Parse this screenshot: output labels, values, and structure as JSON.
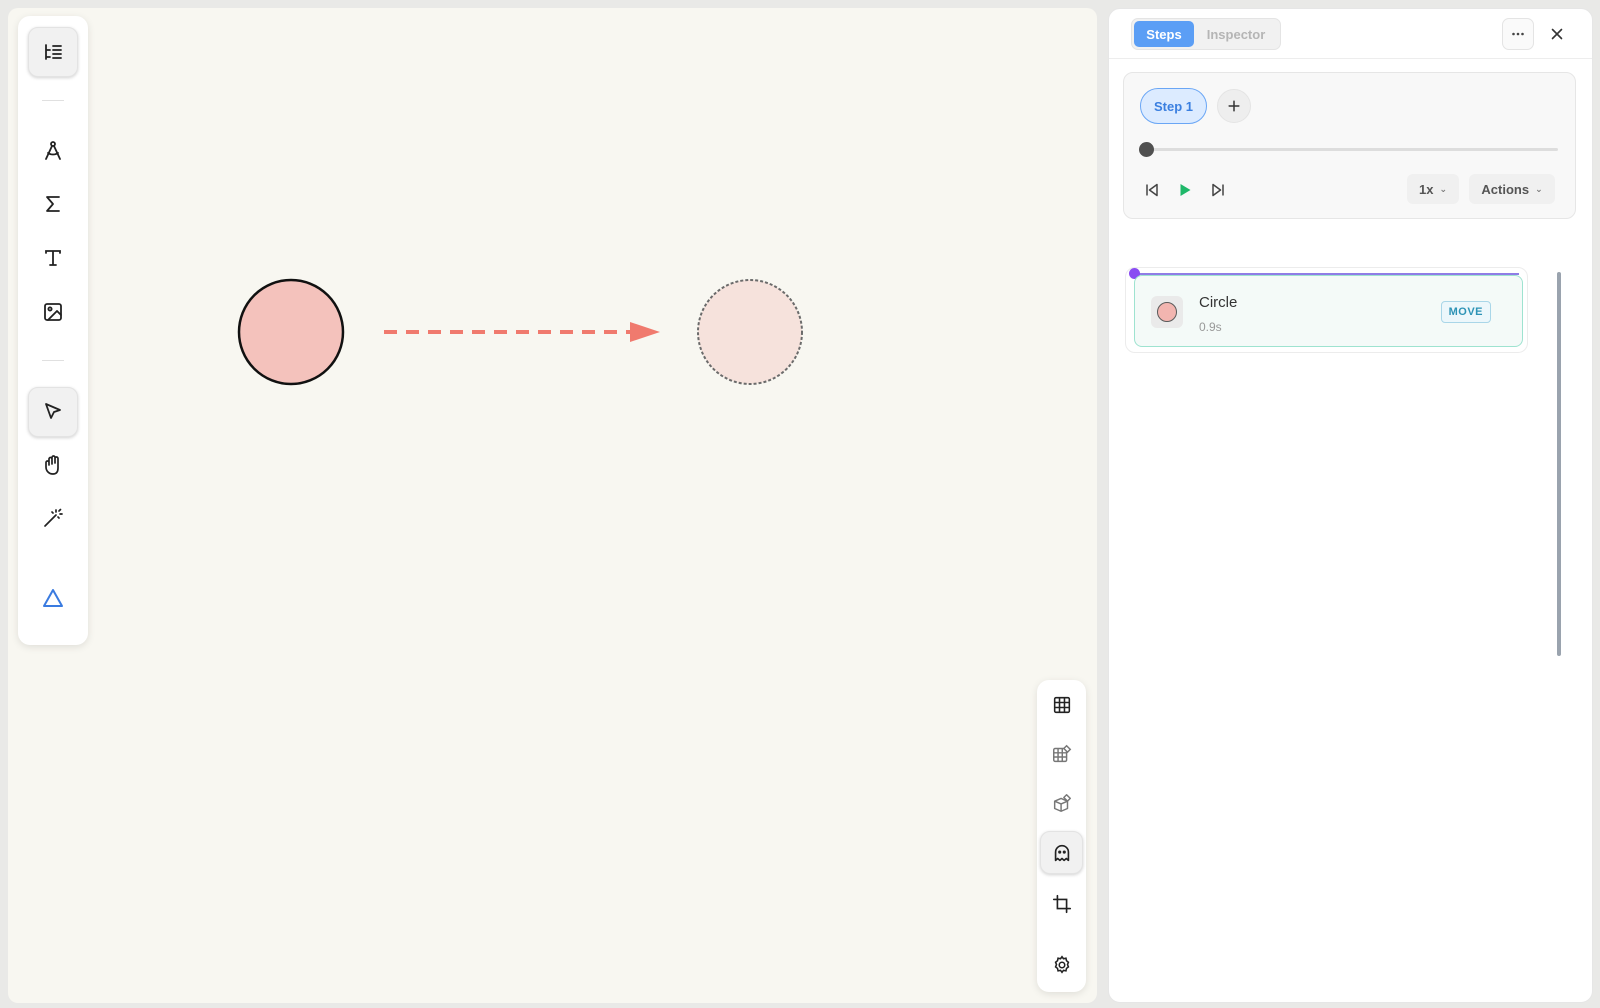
{
  "left_toolbar": {
    "tools": [
      {
        "icon": "outline-list-icon",
        "active": true
      },
      {
        "icon": "compass-icon",
        "active": false
      },
      {
        "icon": "sigma-icon",
        "active": false
      },
      {
        "icon": "text-icon",
        "active": false
      },
      {
        "icon": "image-icon",
        "active": false
      },
      {
        "icon": "pointer-icon",
        "active": true
      },
      {
        "icon": "hand-icon",
        "active": false
      },
      {
        "icon": "magic-wand-icon",
        "active": false
      },
      {
        "icon": "triangle-icon",
        "active": false
      }
    ]
  },
  "canvas": {
    "objects": [
      {
        "name": "Circle",
        "fill": "#f4c2bc",
        "stroke": "#111111"
      },
      {
        "name": "Circle ghost",
        "fill": "#f6e2dc",
        "stroke": "#6b6b6b"
      }
    ],
    "motion_arrow": {
      "color": "#f07a6e"
    }
  },
  "right_toolbar": {
    "tools": [
      {
        "icon": "grid-icon",
        "active": false
      },
      {
        "icon": "grid-snap-icon",
        "active": false
      },
      {
        "icon": "cube-snap-icon",
        "active": false
      },
      {
        "icon": "ghost-icon",
        "active": true
      },
      {
        "icon": "crop-icon",
        "active": false
      },
      {
        "icon": "settings-icon",
        "active": false
      }
    ]
  },
  "panel": {
    "tabs": [
      {
        "label": "Steps",
        "active": true
      },
      {
        "label": "Inspector",
        "active": false
      }
    ],
    "header_buttons": [
      "more-icon",
      "close-icon"
    ],
    "steps": {
      "current_step_label": "Step 1",
      "add_icon": "plus-icon",
      "progress": 0,
      "playback": [
        "skip-back-icon",
        "play-icon",
        "skip-forward-icon"
      ],
      "speed": "1x",
      "actions_label": "Actions"
    },
    "timeline": {
      "items": [
        {
          "name": "Circle",
          "duration": "0.9s",
          "action": "MOVE"
        }
      ]
    }
  },
  "colors": {
    "accent": "#5b9ef5",
    "play": "#1fb86a",
    "timeline_marker": "#8a4cf2",
    "badge": "#2d93b6"
  }
}
